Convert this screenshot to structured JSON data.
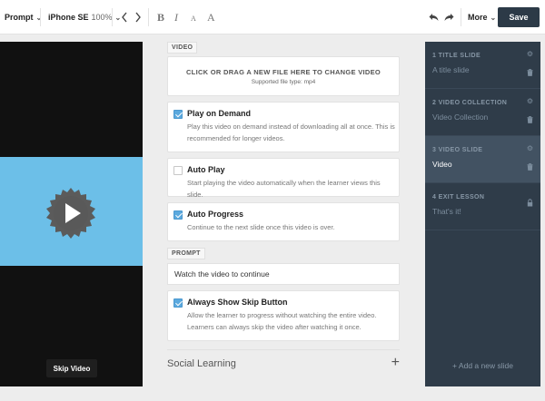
{
  "toolbar": {
    "mode_label": "Prompt",
    "device_label": "iPhone SE",
    "zoom_label": "100%",
    "bold_label": "B",
    "italic_label": "I",
    "small_text_label": "A",
    "large_text_label": "A",
    "more_label": "More",
    "save_label": "Save"
  },
  "preview": {
    "skip_label": "Skip Video"
  },
  "video_section": {
    "label": "VIDEO",
    "upload_title": "CLICK OR DRAG A NEW FILE HERE TO CHANGE VIDEO",
    "upload_hint": "Supported file type: mp4"
  },
  "options": [
    {
      "title": "Play on Demand",
      "description": "Play this video on demand instead of downloading all at once. This is recommended for longer videos.",
      "checked": true
    },
    {
      "title": "Auto Play",
      "description": "Start playing the video automatically when the learner views this slide.",
      "checked": false
    },
    {
      "title": "Auto Progress",
      "description": "Continue to the next slide once this video is over.",
      "checked": true
    }
  ],
  "prompt_section": {
    "label": "PROMPT",
    "value": "Watch the video to continue"
  },
  "skip_option": {
    "title": "Always Show Skip Button",
    "description": "Allow the learner to progress without watching the entire video. Learners can always skip the video after watching it once.",
    "checked": true
  },
  "social": {
    "label": "Social Learning",
    "plus": "+"
  },
  "slides": [
    {
      "title": "1  TITLE SLIDE",
      "subtitle": "A title slide",
      "active": false,
      "locked": false
    },
    {
      "title": "2  VIDEO COLLECTION",
      "subtitle": "Video Collection",
      "active": false,
      "locked": false
    },
    {
      "title": "3  VIDEO SLIDE",
      "subtitle": "Video",
      "active": true,
      "locked": false
    },
    {
      "title": "4  EXIT LESSON",
      "subtitle": "That's it!",
      "active": false,
      "locked": true
    }
  ],
  "add_slide_label": "Add a new slide",
  "colors": {
    "accent": "#5ba9de",
    "save_button": "#2c3a47",
    "slide_panel": "#2f3c49",
    "video_band": "#6cbfe8"
  },
  "icons": [
    "undo-icon",
    "redo-icon",
    "chevron-left-icon",
    "chevron-right-icon",
    "play-icon",
    "gear-icon",
    "trash-icon",
    "lock-icon",
    "plus-icon"
  ]
}
